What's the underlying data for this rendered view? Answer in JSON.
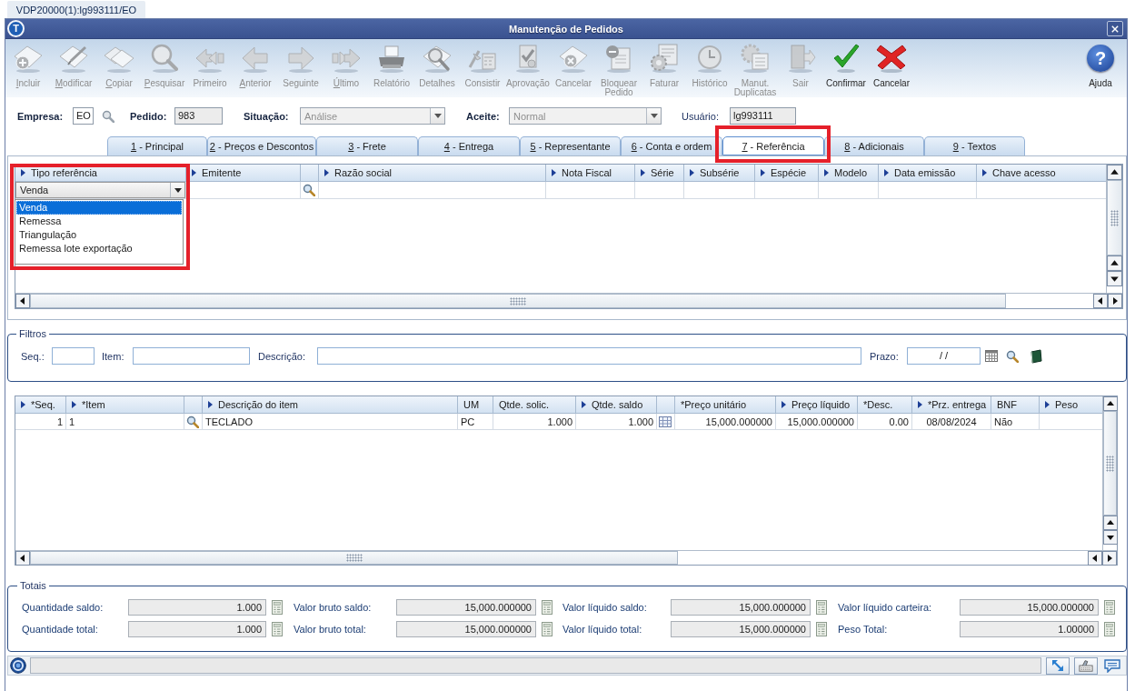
{
  "app_tab": {
    "label": "VDP20000(1):lg993111/EO"
  },
  "window": {
    "title": "Manutenção de Pedidos",
    "logo_text": "T"
  },
  "toolbar": [
    {
      "kind": "add",
      "label": "Incluir",
      "mnemonic": true,
      "disabled": true
    },
    {
      "kind": "edit",
      "label": "Modificar",
      "mnemonic": true,
      "disabled": true
    },
    {
      "kind": "copy",
      "label": "Copiar",
      "mnemonic": true,
      "disabled": true
    },
    {
      "kind": "search",
      "label": "Pesquisar",
      "mnemonic": true,
      "disabled": true
    },
    {
      "kind": "first",
      "label": "Primeiro",
      "mnemonic": false,
      "disabled": true
    },
    {
      "kind": "previous",
      "label": "Anterior",
      "mnemonic": true,
      "disabled": true
    },
    {
      "kind": "next",
      "label": "Seguinte",
      "mnemonic": false,
      "disabled": true
    },
    {
      "kind": "last",
      "label": "Último",
      "mnemonic": true,
      "disabled": true
    },
    {
      "kind": "report",
      "label": "Relatório",
      "mnemonic": false,
      "disabled": true
    },
    {
      "kind": "details",
      "label": "Detalhes",
      "mnemonic": false,
      "disabled": true
    },
    {
      "kind": "validate",
      "label": "Consistir",
      "mnemonic": false,
      "disabled": true
    },
    {
      "kind": "approval",
      "label": "Aprovação",
      "mnemonic": false,
      "disabled": true
    },
    {
      "kind": "void",
      "label": "Cancelar",
      "mnemonic": false,
      "disabled": true
    },
    {
      "kind": "block",
      "label": "Bloquear Pedido",
      "mnemonic": false,
      "disabled": true
    },
    {
      "kind": "invoice",
      "label": "Faturar",
      "mnemonic": false,
      "disabled": true
    },
    {
      "kind": "history",
      "label": "Histórico",
      "mnemonic": false,
      "disabled": true
    },
    {
      "kind": "duplicates",
      "label": "Manut. Duplicatas",
      "mnemonic": false,
      "disabled": true
    },
    {
      "kind": "exit",
      "label": "Sair",
      "mnemonic": false,
      "disabled": true
    },
    {
      "kind": "confirm",
      "label": "Confirmar",
      "mnemonic": false,
      "disabled": false
    },
    {
      "kind": "cancel",
      "label": "Cancelar",
      "mnemonic": false,
      "disabled": false
    }
  ],
  "help_button": {
    "label": "Ajuda",
    "icon_text": "?"
  },
  "header_fields": [
    {
      "kind": "input",
      "label": "Empresa:",
      "value": "EO",
      "required": true,
      "readonly": false,
      "lookup": true
    },
    {
      "kind": "input",
      "label": "Pedido:",
      "value": "983",
      "required": true,
      "readonly": true,
      "lookup": false
    },
    {
      "kind": "combo",
      "label": "Situação:",
      "value": "Análise",
      "required": true,
      "disabled": true
    },
    {
      "kind": "combo",
      "label": "Aceite:",
      "value": "Normal",
      "required": true,
      "disabled": true
    },
    {
      "kind": "input",
      "label": "Usuário:",
      "value": "lg993111",
      "required": false,
      "readonly": true,
      "lookup": false
    }
  ],
  "tabs": [
    {
      "label": "1 - Principal",
      "mnemonic": true,
      "selected": false,
      "highlighted": false
    },
    {
      "label": "2 - Preços e Descontos",
      "mnemonic": true,
      "selected": false,
      "highlighted": false
    },
    {
      "label": "3 - Frete",
      "mnemonic": true,
      "selected": false,
      "highlighted": false
    },
    {
      "label": "4 - Entrega",
      "mnemonic": true,
      "selected": false,
      "highlighted": false
    },
    {
      "label": "5 - Representante",
      "mnemonic": true,
      "selected": false,
      "highlighted": false
    },
    {
      "label": "6 - Conta e ordem",
      "mnemonic": true,
      "selected": false,
      "highlighted": false
    },
    {
      "label": "7 - Referência",
      "mnemonic": true,
      "selected": true,
      "highlighted": true
    },
    {
      "label": "8 - Adicionais",
      "mnemonic": true,
      "selected": false,
      "highlighted": false
    },
    {
      "label": "9 - Textos",
      "mnemonic": true,
      "selected": false,
      "highlighted": false
    }
  ],
  "reference_grid": {
    "columns": [
      {
        "kind": "combo",
        "label": "Tipo referência",
        "sortable": true,
        "highlighted": true
      },
      {
        "kind": "text",
        "label": "Emitente",
        "sortable": true,
        "highlighted": false
      },
      {
        "kind": "lookup",
        "sortable": false,
        "highlighted": false
      },
      {
        "kind": "text",
        "label": "Razão social",
        "sortable": true,
        "highlighted": false
      },
      {
        "kind": "text",
        "label": "Nota Fiscal",
        "sortable": true,
        "highlighted": false
      },
      {
        "kind": "text",
        "label": "Série",
        "sortable": true,
        "highlighted": false
      },
      {
        "kind": "text",
        "label": "Subsérie",
        "sortable": true,
        "highlighted": false
      },
      {
        "kind": "text",
        "label": "Espécie",
        "sortable": true,
        "highlighted": false
      },
      {
        "kind": "text",
        "label": "Modelo",
        "sortable": true,
        "highlighted": false
      },
      {
        "kind": "text",
        "label": "Data emissão",
        "sortable": true,
        "highlighted": false
      },
      {
        "kind": "text",
        "label": "Chave acesso",
        "sortable": true,
        "highlighted": false
      }
    ],
    "rows": [
      {
        "type_combo": {
          "value": "Venda",
          "expanded": true,
          "options": [
            {
              "label": "Venda",
              "selected": true
            },
            {
              "label": "Remessa",
              "selected": false
            },
            {
              "label": "Triangulação",
              "selected": false
            },
            {
              "label": "Remessa lote exportação",
              "selected": false
            }
          ]
        }
      }
    ]
  },
  "filters": {
    "title": "Filtros",
    "fields": [
      {
        "label": "Seq.:"
      },
      {
        "label": "Item:"
      },
      {
        "label": "Descrição:"
      },
      {
        "label": "Prazo:",
        "value": "/ /"
      }
    ]
  },
  "items_grid": {
    "columns": [
      {
        "kind": "text",
        "label": "*Seq.",
        "sortable": true
      },
      {
        "kind": "text",
        "label": "*Item",
        "sortable": true
      },
      {
        "kind": "lookup",
        "sortable": false
      },
      {
        "kind": "text",
        "label": "Descrição do item",
        "sortable": true
      },
      {
        "kind": "text",
        "label": "UM",
        "sortable": false
      },
      {
        "kind": "text",
        "label": "Qtde. solic.",
        "sortable": false
      },
      {
        "kind": "text",
        "label": "Qtde. saldo",
        "sortable": true
      },
      {
        "kind": "picker",
        "sortable": false
      },
      {
        "kind": "text",
        "label": "*Preço unitário",
        "sortable": false
      },
      {
        "kind": "text",
        "label": "Preço líquido",
        "sortable": true
      },
      {
        "kind": "text",
        "label": "*Desc.",
        "sortable": false
      },
      {
        "kind": "text",
        "label": "*Prz. entrega",
        "sortable": true
      },
      {
        "kind": "text",
        "label": "BNF",
        "sortable": false
      },
      {
        "kind": "text",
        "label": "Peso",
        "sortable": true
      }
    ],
    "rows": [
      {
        "cells": [
          "1",
          "1",
          "",
          "TECLADO",
          "PC",
          "1.000",
          "1.000",
          "",
          "15,000.000000",
          "15,000.000000",
          "0.00",
          "08/08/2024",
          "Não",
          ""
        ]
      }
    ]
  },
  "totals": {
    "title": "Totais",
    "items": [
      {
        "label": "Quantidade saldo:",
        "value": "1.000"
      },
      {
        "label": "Valor bruto saldo:",
        "value": "15,000.000000"
      },
      {
        "label": "Valor líquido saldo:",
        "value": "15,000.000000"
      },
      {
        "label": "Valor líquido carteira:",
        "value": "15,000.000000"
      },
      {
        "label": "Quantidade total:",
        "value": "1.000"
      },
      {
        "label": "Valor bruto total:",
        "value": "15,000.000000"
      },
      {
        "label": "Valor líquido total:",
        "value": "15,000.000000"
      },
      {
        "label": "Peso Total:",
        "value": "1.00000"
      }
    ]
  }
}
